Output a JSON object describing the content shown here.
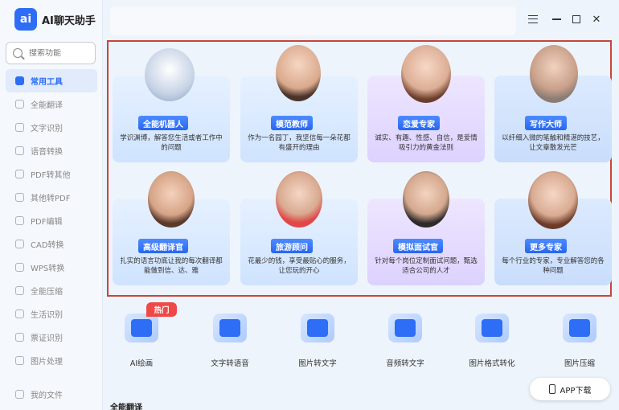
{
  "app": {
    "logo_text": "ai",
    "title": "AI聊天助手"
  },
  "search": {
    "placeholder": "搜索功能"
  },
  "sidebar": {
    "items": [
      {
        "label": "常用工具",
        "active": true
      },
      {
        "label": "全能翻译"
      },
      {
        "label": "文字识别"
      },
      {
        "label": "语音转换"
      },
      {
        "label": "PDF转其他"
      },
      {
        "label": "其他转PDF"
      },
      {
        "label": "PDF编辑"
      },
      {
        "label": "CAD转换"
      },
      {
        "label": "WPS转换"
      },
      {
        "label": "全能压缩"
      },
      {
        "label": "生活识别"
      },
      {
        "label": "票证识别"
      },
      {
        "label": "图片处理"
      }
    ],
    "bottom": {
      "label": "我的文件"
    }
  },
  "window": {
    "menu_icon": "menu-icon",
    "minimize_icon": "minimize-icon",
    "maximize_icon": "maximize-icon",
    "close_icon": "close-icon"
  },
  "experts": [
    {
      "name": "全能机器人",
      "desc": "学识渊博，解答您生活或者工作中的问题"
    },
    {
      "name": "模范教师",
      "desc": "作为一名园丁，我坚信每一朵花都有盛开的理由"
    },
    {
      "name": "恋爱专家",
      "desc": "诚实、有趣、性感、自信，是爱情吸引力的黄金法则"
    },
    {
      "name": "写作大师",
      "desc": "以纤细入微的笔触和精湛的技艺，让文章散发光芒"
    },
    {
      "name": "高级翻译官",
      "desc": "扎实的语言功底让我的每次翻译都能做到信、达、雅"
    },
    {
      "name": "旅游顾问",
      "desc": "花最少的钱，享受最贴心的服务，让您玩的开心"
    },
    {
      "name": "模拟面试官",
      "desc": "针对每个岗位定制面试问题，甄选适合公司的人才"
    },
    {
      "name": "更多专家",
      "desc": "每个行业的专家，专业解答您的各种问题"
    }
  ],
  "tools": [
    {
      "name": "AI绘画",
      "icon": "ai-paint-icon"
    },
    {
      "name": "文字转语音",
      "icon": "text-to-speech-icon"
    },
    {
      "name": "图片转文字",
      "icon": "image-to-text-icon"
    },
    {
      "name": "音频转文字",
      "icon": "audio-to-text-icon"
    },
    {
      "name": "图片格式转化",
      "icon": "image-format-icon"
    },
    {
      "name": "图片压缩",
      "icon": "image-compress-icon"
    }
  ],
  "hot_badge": "热门",
  "app_download": "APP下载",
  "section_title": "全能翻译"
}
